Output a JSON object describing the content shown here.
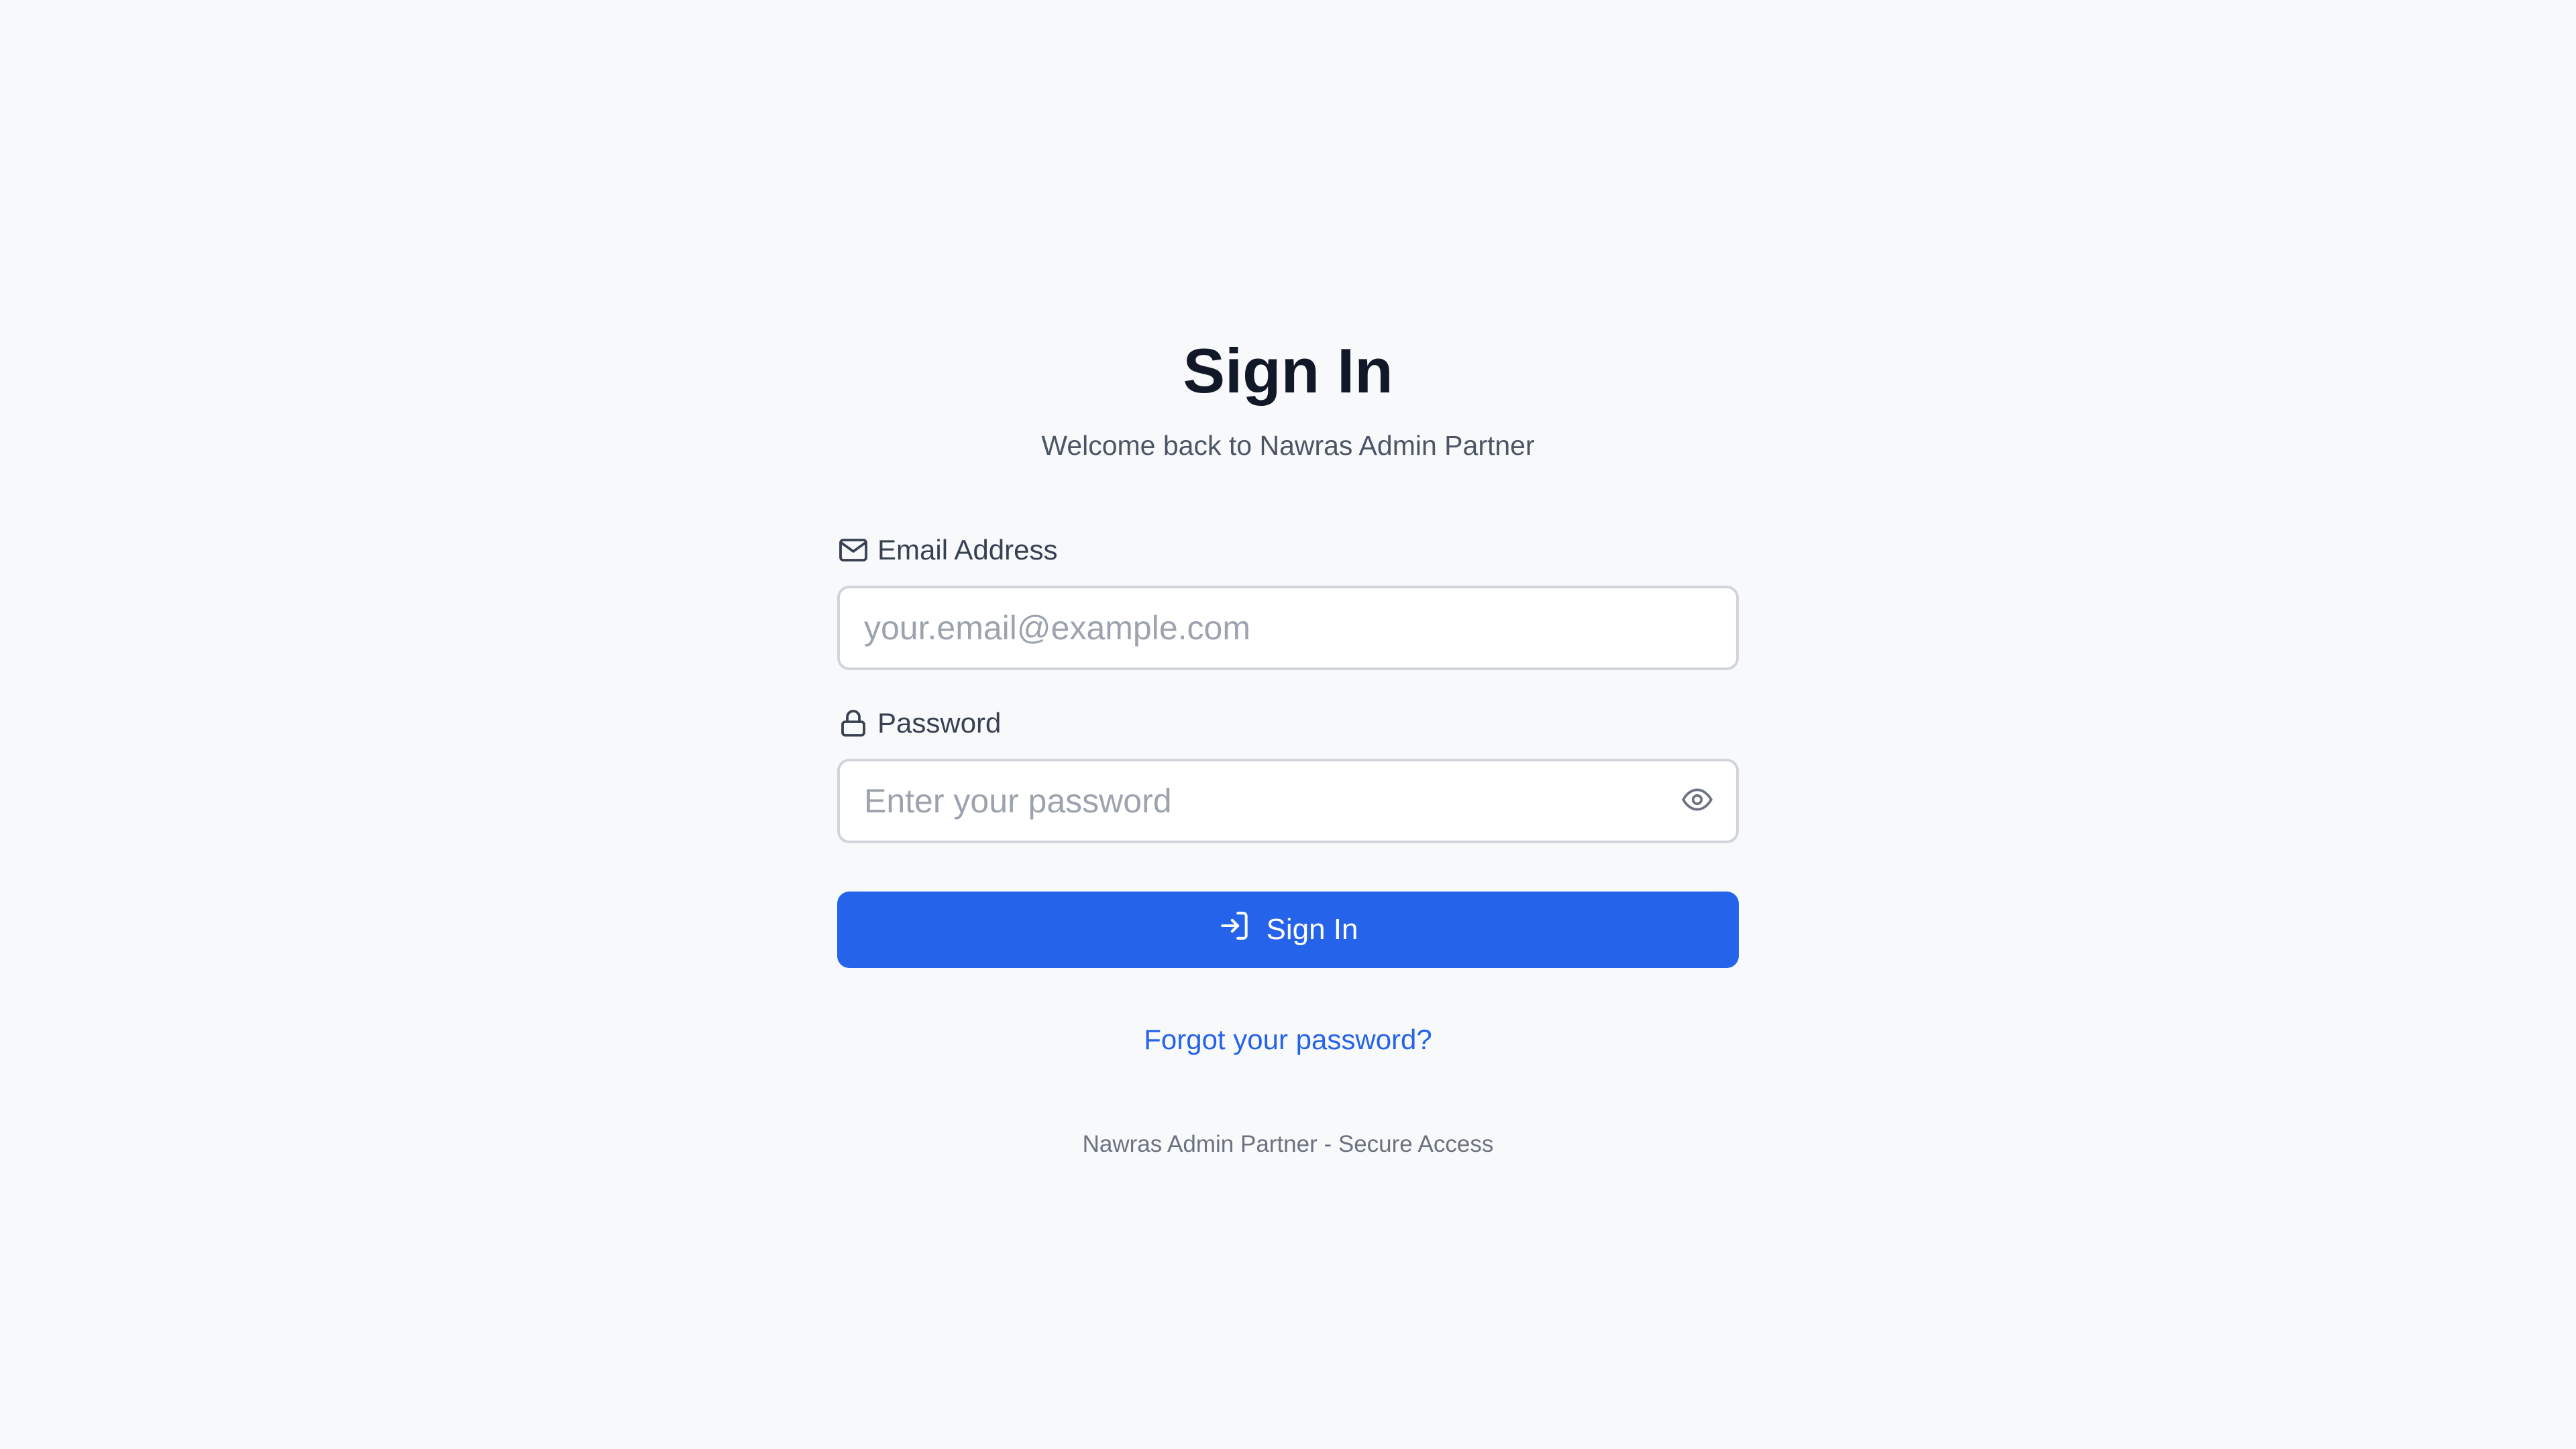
{
  "header": {
    "title": "Sign In",
    "subtitle": "Welcome back to Nawras Admin Partner"
  },
  "form": {
    "email": {
      "label": "Email Address",
      "icon": "mail-icon",
      "value": "",
      "placeholder": "your.email@example.com"
    },
    "password": {
      "label": "Password",
      "icon": "lock-icon",
      "value": "",
      "placeholder": "Enter your password",
      "toggle_icon": "eye-icon"
    },
    "submit": {
      "label": "Sign In",
      "icon": "sign-in-icon"
    }
  },
  "links": {
    "forgot_password": "Forgot your password?"
  },
  "footer": {
    "text": "Nawras Admin Partner - Secure Access"
  },
  "colors": {
    "background": "#f8f9fb",
    "primary": "#2563eb",
    "title_text": "#111827",
    "muted_text": "#4b5563",
    "input_border": "#d1d5db",
    "placeholder": "#9ca3af"
  }
}
